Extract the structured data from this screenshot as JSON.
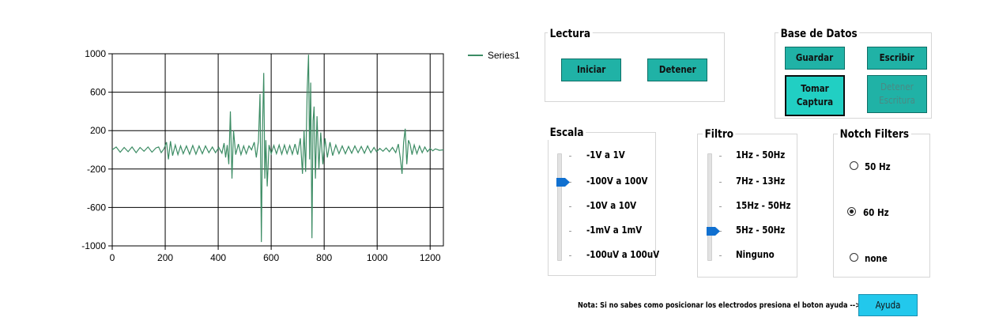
{
  "chart_data": {
    "type": "line",
    "xlim": [
      0,
      1250
    ],
    "ylim": [
      -1000,
      1000
    ],
    "x_ticks": [
      "0",
      "200",
      "400",
      "600",
      "800",
      "1000",
      "1200"
    ],
    "y_ticks": [
      "1000",
      "600",
      "200",
      "-200",
      "-600",
      "-1000"
    ],
    "grid": true,
    "legend_position": "top-right",
    "series": [
      {
        "name": "Series1",
        "color": "#3c8c64",
        "points": [
          [
            0,
            0
          ],
          [
            15,
            30
          ],
          [
            30,
            -25
          ],
          [
            45,
            25
          ],
          [
            60,
            -20
          ],
          [
            75,
            30
          ],
          [
            90,
            -30
          ],
          [
            105,
            25
          ],
          [
            120,
            -15
          ],
          [
            135,
            30
          ],
          [
            150,
            -25
          ],
          [
            165,
            20
          ],
          [
            175,
            30
          ],
          [
            185,
            -30
          ],
          [
            195,
            10
          ],
          [
            205,
            80
          ],
          [
            212,
            -100
          ],
          [
            220,
            90
          ],
          [
            228,
            -60
          ],
          [
            238,
            50
          ],
          [
            248,
            -50
          ],
          [
            258,
            40
          ],
          [
            268,
            -40
          ],
          [
            280,
            40
          ],
          [
            292,
            -45
          ],
          [
            304,
            45
          ],
          [
            316,
            -45
          ],
          [
            328,
            40
          ],
          [
            340,
            -40
          ],
          [
            352,
            40
          ],
          [
            365,
            -30
          ],
          [
            378,
            30
          ],
          [
            390,
            -30
          ],
          [
            402,
            25
          ],
          [
            414,
            -35
          ],
          [
            422,
            70
          ],
          [
            428,
            -80
          ],
          [
            434,
            50
          ],
          [
            440,
            -150
          ],
          [
            446,
            400
          ],
          [
            452,
            -300
          ],
          [
            458,
            200
          ],
          [
            466,
            -50
          ],
          [
            476,
            60
          ],
          [
            486,
            -50
          ],
          [
            496,
            40
          ],
          [
            506,
            -40
          ],
          [
            516,
            40
          ],
          [
            526,
            0
          ],
          [
            536,
            80
          ],
          [
            544,
            -80
          ],
          [
            552,
            90
          ],
          [
            558,
            580
          ],
          [
            563,
            -960
          ],
          [
            567,
            200
          ],
          [
            572,
            800
          ],
          [
            576,
            -300
          ],
          [
            580,
            100
          ],
          [
            585,
            -380
          ],
          [
            592,
            50
          ],
          [
            600,
            -40
          ],
          [
            610,
            45
          ],
          [
            620,
            -40
          ],
          [
            630,
            50
          ],
          [
            640,
            -45
          ],
          [
            650,
            50
          ],
          [
            660,
            -40
          ],
          [
            670,
            45
          ],
          [
            680,
            -45
          ],
          [
            690,
            60
          ],
          [
            700,
            -50
          ],
          [
            710,
            120
          ],
          [
            718,
            -250
          ],
          [
            724,
            200
          ],
          [
            730,
            -230
          ],
          [
            736,
            630
          ],
          [
            741,
            990
          ],
          [
            745,
            -100
          ],
          [
            749,
            700
          ],
          [
            754,
            -920
          ],
          [
            758,
            300
          ],
          [
            762,
            450
          ],
          [
            767,
            -300
          ],
          [
            773,
            350
          ],
          [
            780,
            -200
          ],
          [
            787,
            180
          ],
          [
            795,
            -150
          ],
          [
            803,
            120
          ],
          [
            812,
            -80
          ],
          [
            822,
            80
          ],
          [
            832,
            -60
          ],
          [
            844,
            50
          ],
          [
            856,
            -40
          ],
          [
            868,
            40
          ],
          [
            880,
            -40
          ],
          [
            892,
            35
          ],
          [
            904,
            -35
          ],
          [
            916,
            40
          ],
          [
            928,
            -30
          ],
          [
            940,
            35
          ],
          [
            952,
            -35
          ],
          [
            964,
            40
          ],
          [
            976,
            -30
          ],
          [
            988,
            25
          ],
          [
            998,
            -20
          ],
          [
            1010,
            15
          ],
          [
            1022,
            -15
          ],
          [
            1034,
            20
          ],
          [
            1046,
            -20
          ],
          [
            1058,
            25
          ],
          [
            1070,
            -30
          ],
          [
            1080,
            60
          ],
          [
            1088,
            -100
          ],
          [
            1094,
            -250
          ],
          [
            1100,
            80
          ],
          [
            1106,
            220
          ],
          [
            1112,
            -150
          ],
          [
            1118,
            100
          ],
          [
            1124,
            60
          ],
          [
            1132,
            -50
          ],
          [
            1140,
            50
          ],
          [
            1150,
            -40
          ],
          [
            1160,
            40
          ],
          [
            1170,
            -30
          ],
          [
            1180,
            30
          ],
          [
            1190,
            -20
          ],
          [
            1200,
            15
          ],
          [
            1210,
            -10
          ],
          [
            1220,
            10
          ],
          [
            1235,
            -5
          ],
          [
            1250,
            0
          ]
        ]
      }
    ]
  },
  "lectura": {
    "title": "Lectura",
    "start_label": "Iniciar",
    "stop_label": "Detener"
  },
  "base_datos": {
    "title": "Base de Datos",
    "save_label": "Guardar",
    "write_label": "Escribir",
    "capture_label": "Tomar Captura",
    "stop_write_label": "Detener Escritura"
  },
  "escala": {
    "title": "Escala",
    "options": [
      "-1V a 1V",
      "-100V a 100V",
      "-10V a 10V",
      "-1mV a 1mV",
      "-100uV a 100uV"
    ],
    "selected_index": 1,
    "accent": "#1070d0"
  },
  "filtro": {
    "title": "Filtro",
    "options": [
      "1Hz - 50Hz",
      "7Hz - 13Hz",
      "15Hz - 50Hz",
      "5Hz - 50Hz",
      "Ninguno"
    ],
    "selected_index": 3,
    "accent": "#1070d0"
  },
  "notch": {
    "title": "Notch Filters",
    "options": [
      "50 Hz",
      "60 Hz",
      "none"
    ],
    "selected_index": 1
  },
  "footer": {
    "note": "Nota: Si no sabes como posicionar los electrodos presiona el boton ayuda -->",
    "help_label": "Ayuda"
  }
}
